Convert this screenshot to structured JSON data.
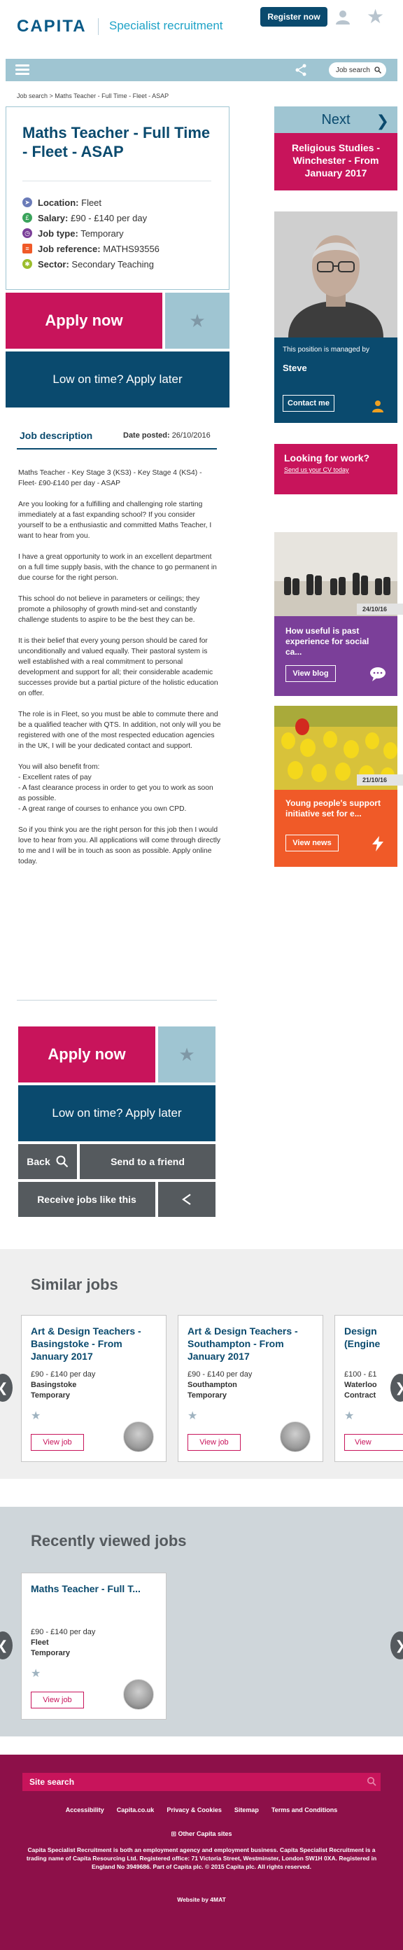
{
  "header": {
    "logo": "CAPITA",
    "tagline": "Specialist recruitment",
    "register_label": "Register now"
  },
  "nav": {
    "search_label": "Job search"
  },
  "breadcrumb": "Job search > Maths Teacher - Full Time - Fleet - ASAP",
  "job": {
    "title": "Maths Teacher - Full Time - Fleet - ASAP",
    "location_label": "Location:",
    "location": "Fleet",
    "salary_label": "Salary:",
    "salary": "£90 - £140 per day",
    "type_label": "Job type:",
    "type": "Temporary",
    "ref_label": "Job reference:",
    "ref": "MATHS93556",
    "sector_label": "Sector:",
    "sector": "Secondary Teaching"
  },
  "actions": {
    "apply": "Apply now",
    "apply_later": "Low on time? Apply later",
    "back": "Back",
    "send_friend": "Send to a friend",
    "receive_jobs": "Receive jobs like this"
  },
  "description": {
    "heading": "Job description",
    "date_label": "Date posted:",
    "date": "26/10/2016",
    "paragraphs": [
      "Maths Teacher - Key Stage 3 (KS3) - Key Stage 4 (KS4) - Fleet- £90-£140 per day - ASAP",
      "Are you looking for a fulfilling and challenging role starting immediately at a fast expanding school? If you consider yourself to be a enthusiastic and committed Maths Teacher, I want to hear from you.",
      "I have a great opportunity to work in an excellent department on a full time supply basis, with the chance to go permanent in due course for the right person.",
      "This school do not believe in parameters or ceilings; they promote a philosophy of growth mind-set and constantly challenge students to aspire to be the best they can be.",
      "It is their belief that every young person should be cared for unconditionally and valued equally. Their pastoral system is well established with a real commitment to personal development and support for all; their considerable academic successes provide but a partial picture of the holistic education on offer.",
      "The role is in Fleet, so you must be able to commute there and be a qualified teacher with QTS. In addition, not only will you be registered with one of the most respected education agencies in the UK, I will be your dedicated contact and support.",
      "You will also benefit from:\n- Excellent rates of pay\n- A fast clearance process in order to get you to work as soon as possible.\n- A great range of courses to enhance you own CPD.",
      "So if you think you are the right person for this job then I would love to hear from you. All applications will come through directly to me and I will be in touch as soon as possible. Apply online today."
    ]
  },
  "sidebar": {
    "next_label": "Next",
    "next_job": "Religious Studies - Winchester - From January 2017",
    "managed_by": "This position is managed by",
    "manager_name": "Steve",
    "contact_label": "Contact me",
    "work_title": "Looking for work?",
    "work_sub": "Send us your CV today",
    "blog_date": "24/10/16",
    "blog_title": "How useful is past experience for social ca...",
    "blog_btn": "View blog",
    "news_date": "21/10/16",
    "news_title": "Young people's support initiative set for e...",
    "news_btn": "View news"
  },
  "similar": {
    "heading": "Similar jobs",
    "jobs": [
      {
        "title": "Art & Design Teachers - Basingstoke - From January 2017",
        "salary": "£90 - £140 per day",
        "location": "Basingstoke",
        "type": "Temporary",
        "view": "View job"
      },
      {
        "title": "Art & Design Teachers - Southampton - From January 2017",
        "salary": "£90 - £140 per day",
        "location": "Southampton",
        "type": "Temporary",
        "view": "View job"
      },
      {
        "title": "Design (Engine",
        "salary": "£100 - £1",
        "location": "Waterloo",
        "type": "Contract",
        "view": "View"
      }
    ]
  },
  "recent": {
    "heading": "Recently viewed jobs",
    "jobs": [
      {
        "title": "Maths Teacher - Full T...",
        "salary": "£90 - £140 per day",
        "location": "Fleet",
        "type": "Temporary",
        "view": "View job"
      }
    ]
  },
  "footer": {
    "search_label": "Site search",
    "links": [
      "Accessibility",
      "Capita.co.uk",
      "Privacy & Cookies",
      "Sitemap",
      "Terms and Conditions"
    ],
    "other_sites": "Other Capita sites",
    "legal": "Capita Specialist Recruitment is both an employment agency and employment business. Capita Specialist Recruitment is a trading name of Capita Resourcing Ltd. Registered office: 71 Victoria Street, Westminster, London SW1H 0XA. Registered in England No 3949686. Part of Capita plc. © 2015 Capita plc. All rights reserved.",
    "webby": "Website by 4MAT"
  },
  "colors": {
    "navy": "#0a4a6e",
    "magenta": "#c8145b",
    "light_blue": "#9fc5d2",
    "grey": "#555a5e",
    "purple": "#7b3f99",
    "orange": "#f05a28",
    "footer": "#8d1049"
  }
}
